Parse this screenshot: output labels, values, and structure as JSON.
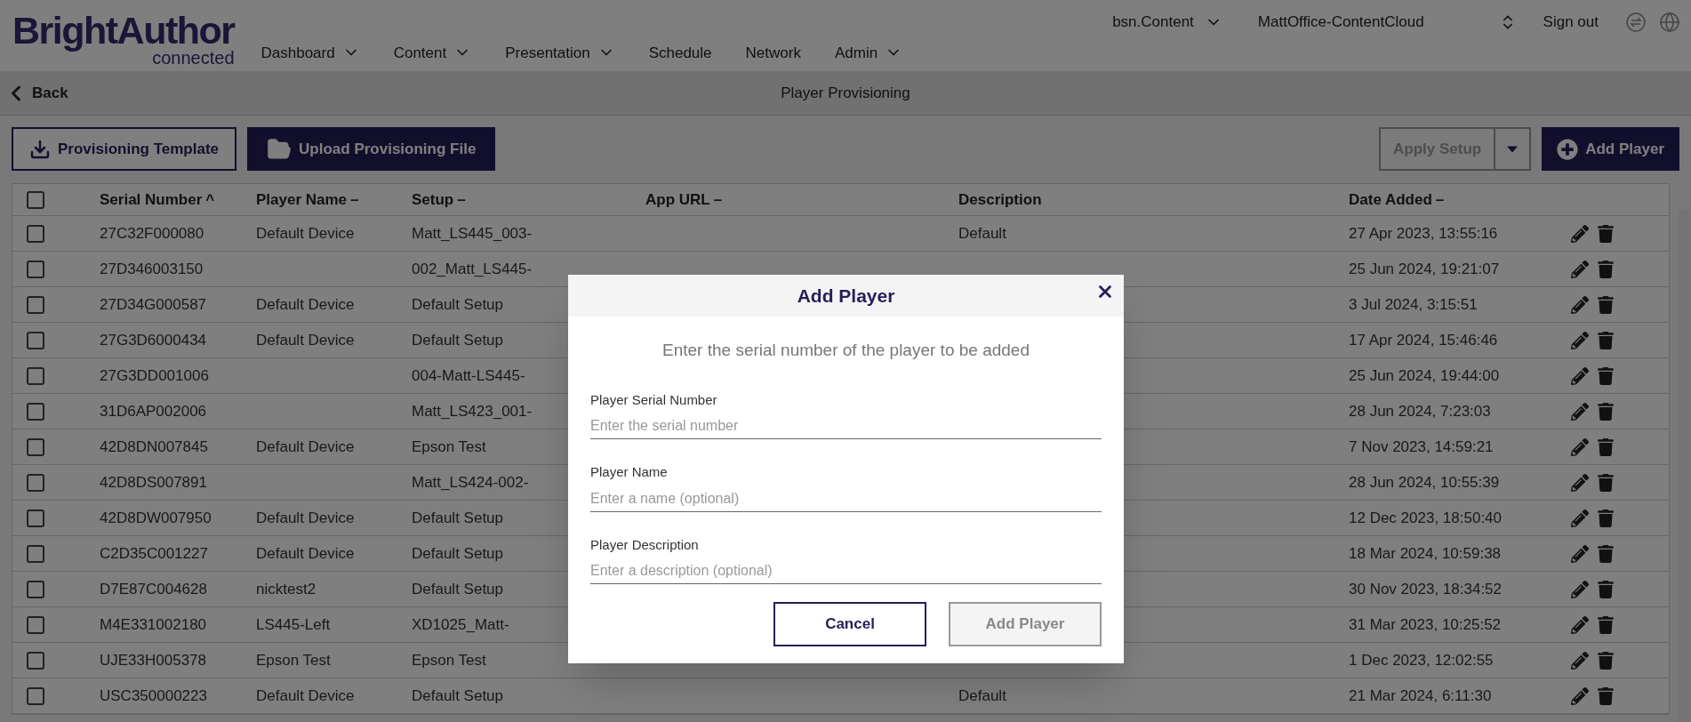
{
  "logo": {
    "name": "BrightAuthor",
    "tagline": "connected"
  },
  "nav": [
    {
      "label": "Dashboard",
      "dropdown": true
    },
    {
      "label": "Content",
      "dropdown": true
    },
    {
      "label": "Presentation",
      "dropdown": true
    },
    {
      "label": "Schedule",
      "dropdown": false
    },
    {
      "label": "Network",
      "dropdown": false
    },
    {
      "label": "Admin",
      "dropdown": true
    }
  ],
  "account": {
    "content_menu": "bsn.Content",
    "network": "MattOffice-ContentCloud",
    "sign_out": "Sign out"
  },
  "back": "Back",
  "page_title": "Player Provisioning",
  "toolbar": {
    "template_button": "Provisioning Template",
    "upload_button": "Upload Provisioning File",
    "apply_setup": {
      "label": "Apply Setup",
      "disabled": true
    },
    "add_button": "Add Player"
  },
  "table": {
    "select_all_checked": false,
    "columns": [
      {
        "label": "Serial Number",
        "sort_mark": "^"
      },
      {
        "label": "Player Name",
        "sort_mark": "–"
      },
      {
        "label": "Setup",
        "sort_mark": "–"
      },
      {
        "label": "App URL",
        "sort_mark": "–"
      },
      {
        "label": "Description"
      },
      {
        "label": "Date Added",
        "sort_mark": "–"
      }
    ],
    "rows": [
      {
        "checked": false,
        "serial": "27C32F000080",
        "name": "Default Device",
        "setup": "Matt_LS445_003-",
        "description": "Default",
        "date": "27 Apr 2023, 13:55:16"
      },
      {
        "checked": false,
        "serial": "27D346003150",
        "setup": "002_Matt_LS445-",
        "date": "25 Jun 2024, 19:21:07"
      },
      {
        "checked": false,
        "serial": "27D34G000587",
        "name": "Default Device",
        "setup": "Default Setup",
        "date": "3 Jul 2024, 3:15:51"
      },
      {
        "checked": false,
        "serial": "27G3D6000434",
        "name": "Default Device",
        "setup": "Default Setup",
        "date": "17 Apr 2024, 15:46:46"
      },
      {
        "checked": false,
        "serial": "27G3DD001006",
        "setup": "004-Matt-LS445-",
        "date": "25 Jun 2024, 19:44:00"
      },
      {
        "checked": false,
        "serial": "31D6AP002006",
        "setup": "Matt_LS423_001-",
        "date": "28 Jun 2024, 7:23:03"
      },
      {
        "checked": false,
        "serial": "42D8DN007845",
        "name": "Default Device",
        "setup": "Epson Test",
        "date": "7 Nov 2023, 14:59:21"
      },
      {
        "checked": false,
        "serial": "42D8DS007891",
        "setup": "Matt_LS424-002-",
        "date": "28 Jun 2024, 10:55:39"
      },
      {
        "checked": false,
        "serial": "42D8DW007950",
        "name": "Default Device",
        "setup": "Default Setup",
        "date": "12 Dec 2023, 18:50:40"
      },
      {
        "checked": false,
        "serial": "C2D35C001227",
        "name": "Default Device",
        "setup": "Default Setup",
        "date": "18 Mar 2024, 10:59:38"
      },
      {
        "checked": false,
        "serial": "D7E87C004628",
        "name": "nicktest2",
        "setup": "Default Setup",
        "date": "30 Nov 2023, 18:34:52"
      },
      {
        "checked": false,
        "serial": "M4E331002180",
        "name": "LS445-Left",
        "setup": "XD1025_Matt-",
        "date": "31 Mar 2023, 10:25:52"
      },
      {
        "checked": false,
        "serial": "UJE33H005378",
        "name": "Epson Test",
        "setup": "Epson Test",
        "date": "1 Dec 2023, 12:02:55"
      },
      {
        "checked": false,
        "serial": "USC350000223",
        "name": "Default Device",
        "setup": "Default Setup",
        "description": "Default",
        "date": "21 Mar 2024, 6:11:30"
      }
    ]
  },
  "dialog": {
    "title": "Add Player",
    "prompt": "Enter the serial number of the player to be added",
    "fields": [
      {
        "label": "Player Serial Number",
        "placeholder": "Enter the serial number"
      },
      {
        "label": "Player Name",
        "placeholder": "Enter a name (optional)"
      },
      {
        "label": "Player Description",
        "placeholder": "Enter a description (optional)"
      }
    ],
    "cancel": "Cancel",
    "submit": {
      "label": "Add Player",
      "disabled": true
    }
  }
}
